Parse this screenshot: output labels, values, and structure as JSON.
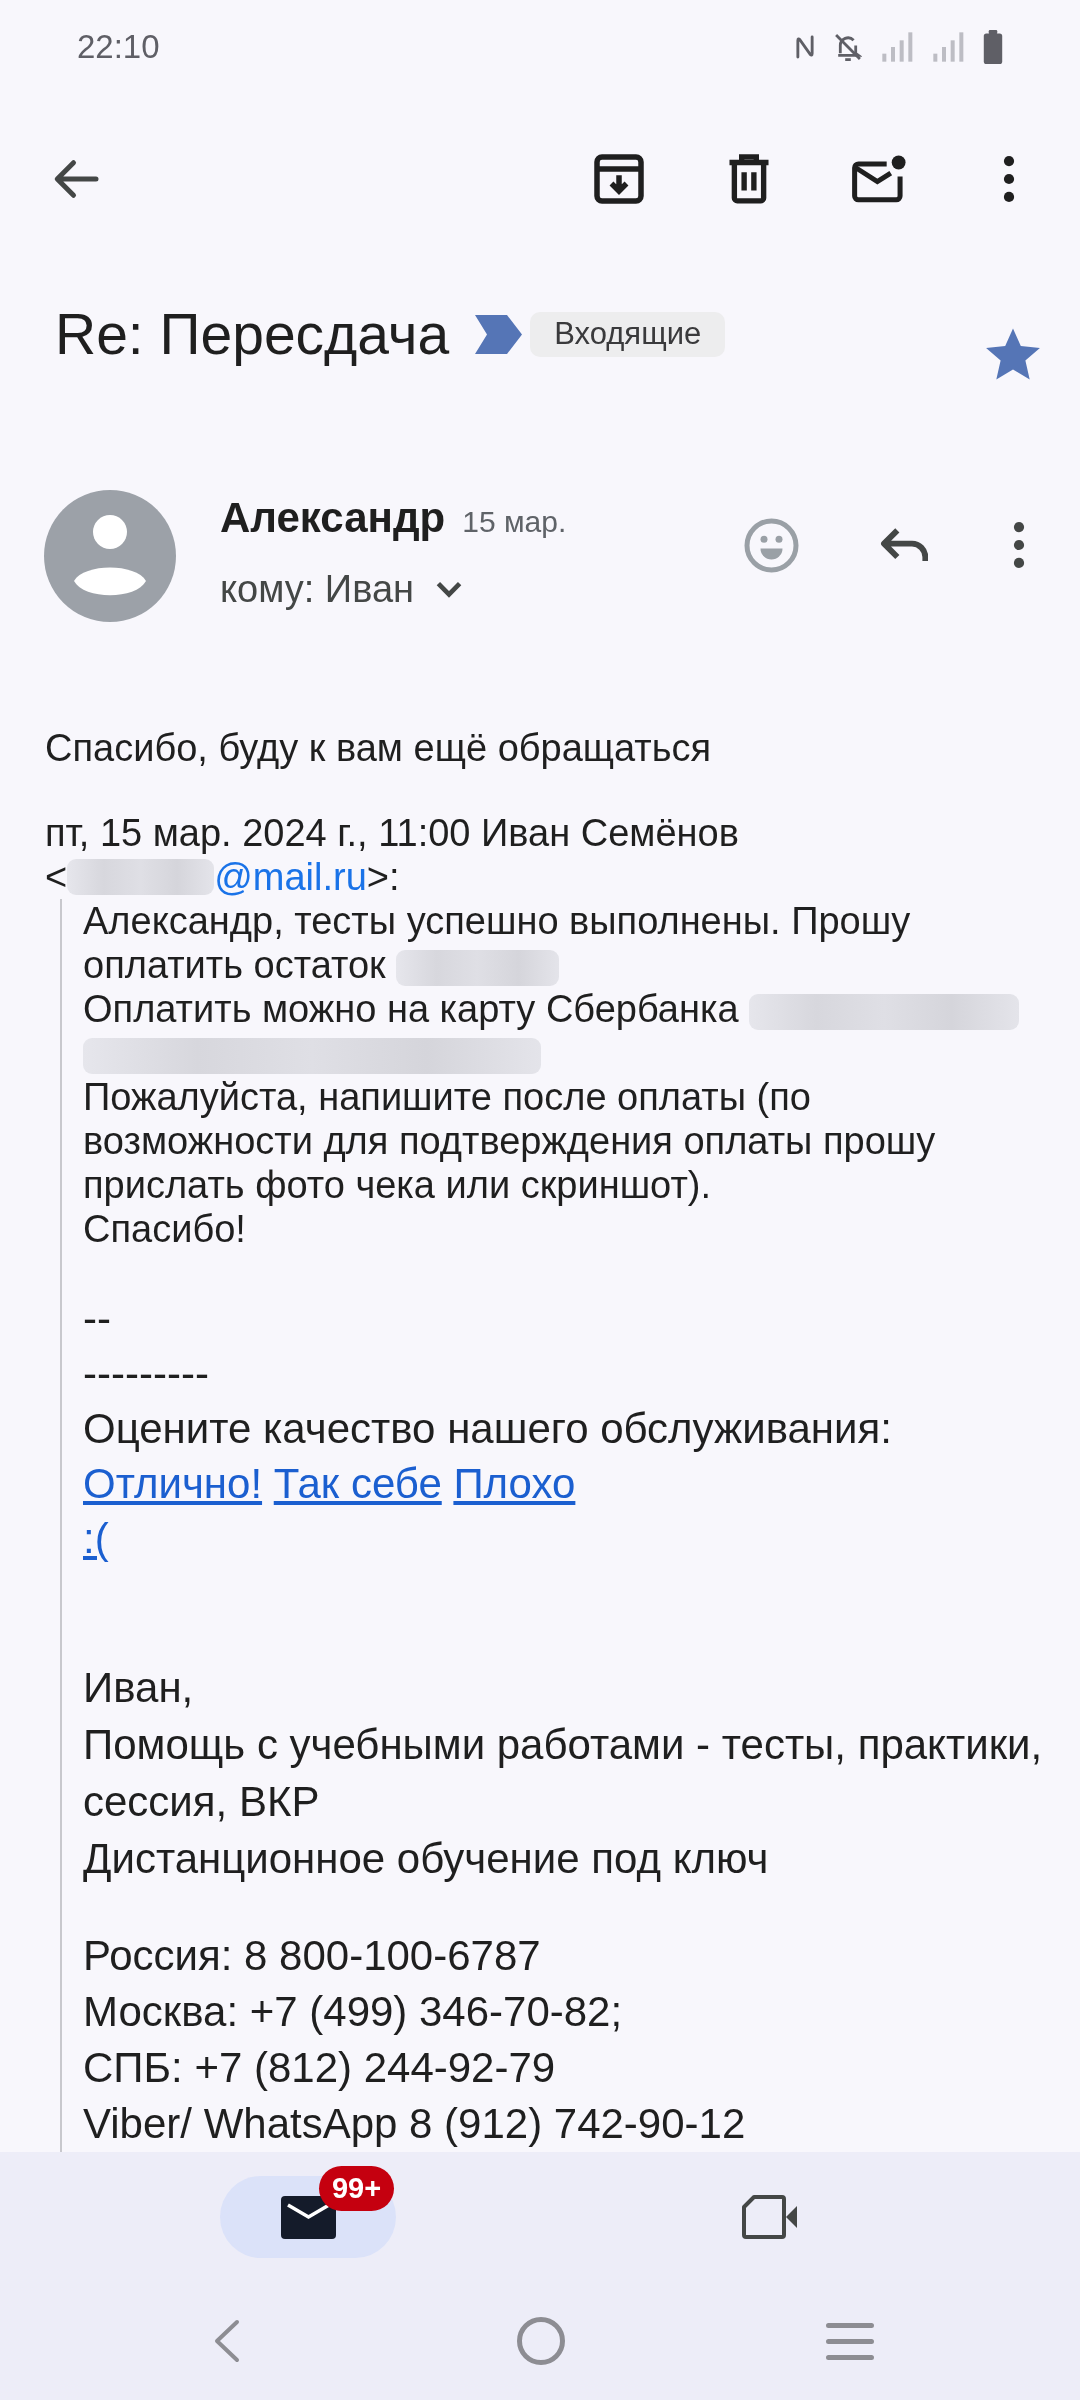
{
  "status_bar": {
    "time": "22:10"
  },
  "subject": {
    "title": "Re: Пересдача",
    "important": true,
    "label": "Входящие",
    "starred": true
  },
  "message": {
    "sender": "Александр",
    "date": "15 мар.",
    "recipient": "кому: Иван",
    "body": "Спасибо, буду к вам ещё обращаться",
    "quote_header": "пт, 15 мар. 2024 г., 11:00 Иван Семёнов",
    "quote_email": {
      "open": "<",
      "domain": "@mail.ru",
      "close": ">:"
    },
    "quote": [
      {
        "kind": "message",
        "items": [
          {
            "segments": [
              {
                "kind": "plain",
                "lines": [
                  "Александр, тесты успешно выполнены. Прошу"
                ]
              }
            ]
          },
          {
            "segments": [
              {
                "kind": "plain",
                "lines": [
                  "оплатить остаток"
                ]
              },
              {
                "kind": "blurred"
              }
            ]
          },
          {
            "segments": [
              {
                "kind": "plain",
                "lines": [
                  "Оплатить можно на карту Сбербанка"
                ]
              },
              {
                "kind": "blurred"
              },
              {
                "kind": "blurred"
              }
            ]
          },
          {
            "segments": [
              {
                "kind": "plain",
                "lines": [
                  "Пожалуйста, напишите после оплаты (по",
                  "возможности для подтверждения оплаты прошу",
                  "прислать фото чека или скриншот)."
                ]
              }
            ]
          },
          {
            "segments": [
              {
                "kind": "plain",
                "lines": [
                  "Спасибо!"
                ]
              }
            ]
          }
        ]
      },
      {
        "kind": "rating",
        "items": [
          {
            "segments": [
              {
                "kind": "plain",
                "lines": [
                  "--"
                ]
              }
            ]
          },
          {
            "segments": [
              {
                "kind": "plain",
                "lines": [
                  "---------"
                ]
              }
            ]
          },
          {
            "segments": [
              {
                "kind": "plain",
                "lines": [
                  "Оцените качество нашего обслуживания:"
                ]
              }
            ]
          },
          {
            "segments": [
              {
                "kind": "link",
                "text": "Отлично!"
              },
              {
                "kind": "link",
                "text": "Так себе"
              },
              {
                "kind": "link",
                "text": "Плохо"
              }
            ]
          },
          {
            "segments": [
              {
                "kind": "link",
                "text": ":("
              }
            ]
          }
        ]
      },
      {
        "kind": "signature",
        "items": [
          {
            "segments": [
              {
                "kind": "plain",
                "lines": [
                  "Иван,"
                ]
              }
            ]
          },
          {
            "segments": [
              {
                "kind": "plain",
                "lines": [
                  "Помощь с учебными работами - тесты, практики,",
                  "сессия, ВКР"
                ]
              }
            ]
          },
          {
            "segments": [
              {
                "kind": "plain",
                "lines": [
                  "Дистанционное обучение под ключ"
                ]
              }
            ]
          }
        ]
      },
      {
        "kind": "contacts",
        "items": [
          {
            "segments": [
              {
                "kind": "plain",
                "lines": [
                  "Россия: 8 800-100-6787"
                ]
              }
            ]
          },
          {
            "segments": [
              {
                "kind": "plain",
                "lines": [
                  "Москва: +7 (499) 346-70-82;"
                ]
              }
            ]
          },
          {
            "segments": [
              {
                "kind": "plain",
                "lines": [
                  "СПБ: +7 (812) 244-92-79"
                ]
              }
            ]
          },
          {
            "segments": [
              {
                "kind": "plain",
                "lines": [
                  "Viber/ WhatsApp 8 (912) 742-90-12"
                ]
              }
            ]
          }
        ]
      }
    ]
  },
  "bottom_nav": [
    {
      "kind": "mail",
      "selected": true,
      "badge": "99+"
    },
    {
      "kind": "video",
      "selected": false
    }
  ]
}
